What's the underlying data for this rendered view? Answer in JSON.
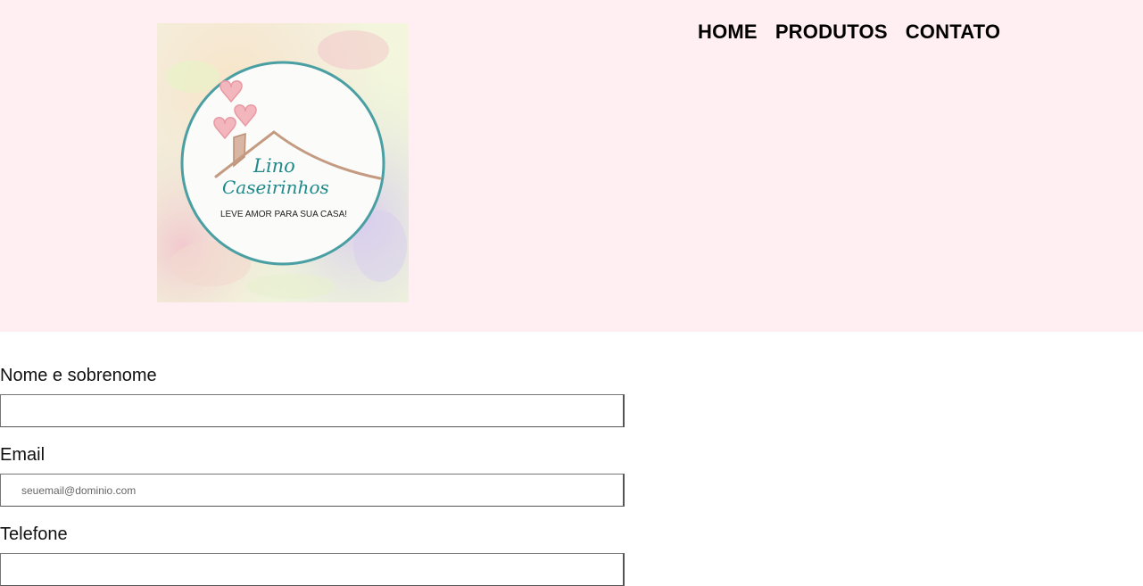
{
  "logo": {
    "brand_line1": "Lino",
    "brand_line2": "Caseirinhos",
    "tagline": "LEVE AMOR PARA SUA CASA!"
  },
  "nav": {
    "items": [
      "HOME",
      "PRODUTOS",
      "CONTATO"
    ]
  },
  "form": {
    "name_label": "Nome e sobrenome",
    "name_value": "",
    "email_label": "Email",
    "email_placeholder": "seuemail@dominio.com",
    "email_value": "",
    "phone_label": "Telefone",
    "phone_value": ""
  },
  "colors": {
    "header_bg": "#ffeef2",
    "logo_ring": "#4a9fa3",
    "logo_text": "#1f8a8a",
    "roof": "#c49a80",
    "hearts": "#f4b6bd"
  }
}
